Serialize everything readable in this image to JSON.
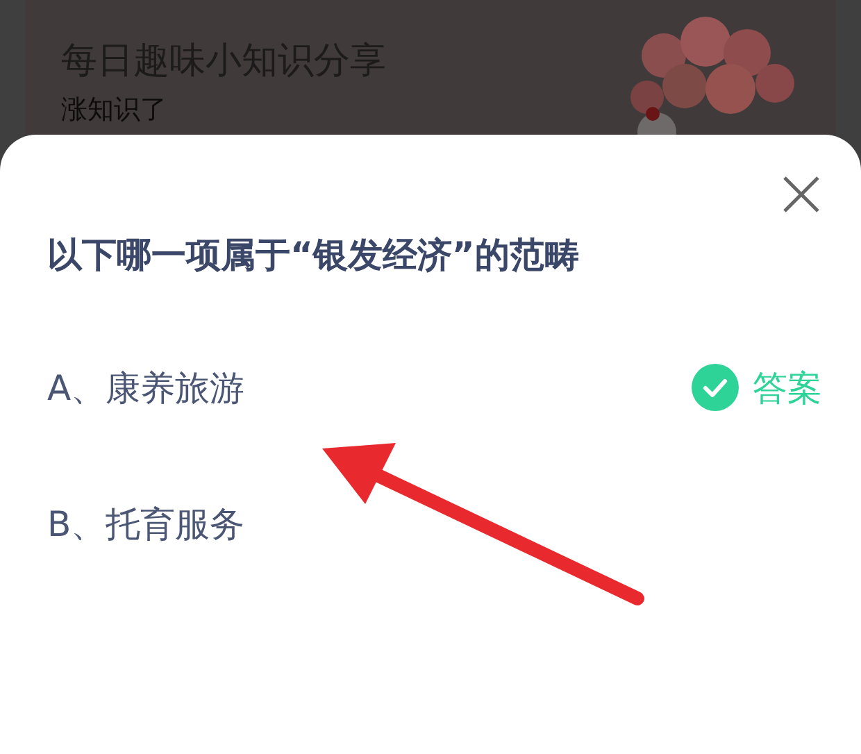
{
  "background_card": {
    "title": "每日趣味小知识分享",
    "subtitle": "涨知识了"
  },
  "sheet": {
    "question": "以下哪一项属于“银发经济”的范畴",
    "answer_label": "答案",
    "options": [
      {
        "label": "A、康养旅游",
        "correct": true
      },
      {
        "label": "B、托育服务",
        "correct": false
      }
    ]
  }
}
